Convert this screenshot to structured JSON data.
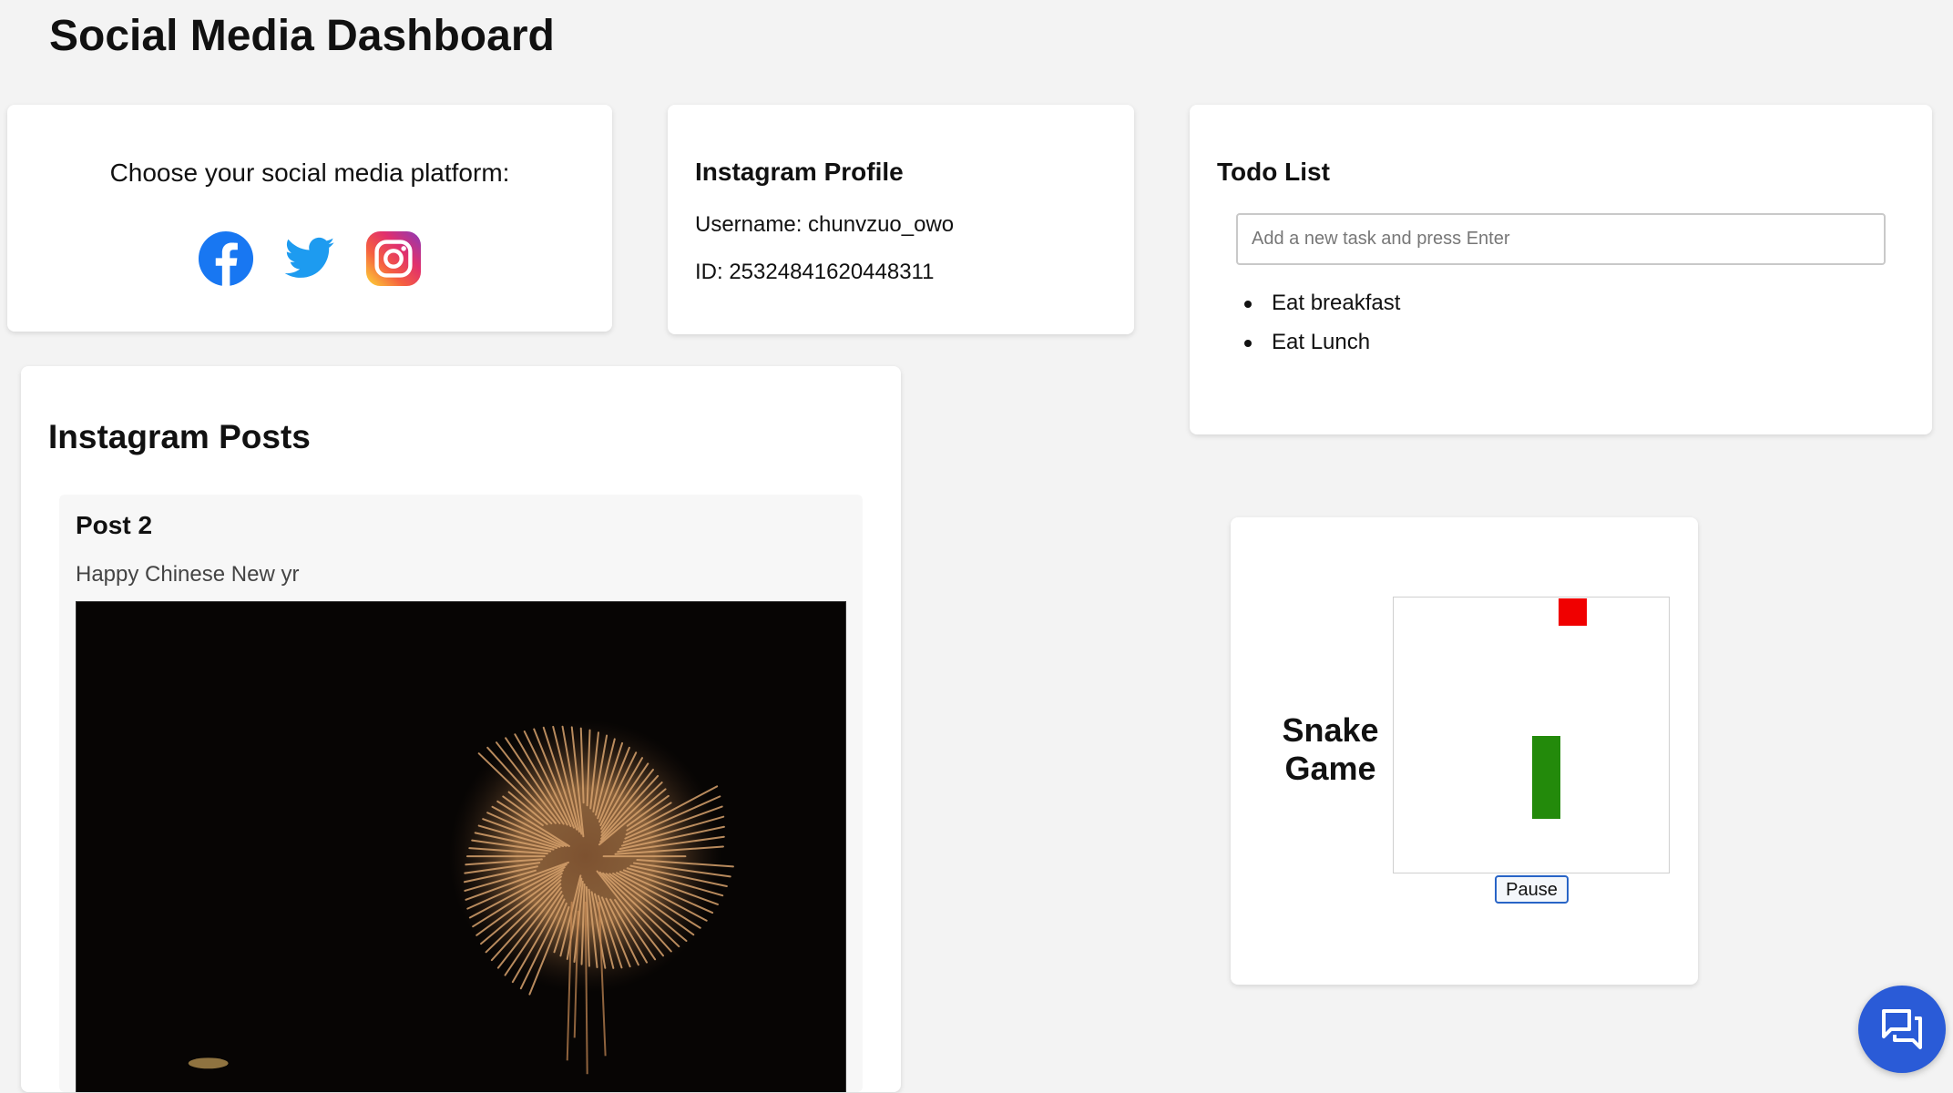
{
  "header": {
    "title": "Social Media Dashboard"
  },
  "platform_chooser": {
    "label": "Choose your social media platform:",
    "platforms": [
      {
        "name": "facebook",
        "icon": "facebook-icon",
        "color": "#1877f2"
      },
      {
        "name": "twitter",
        "icon": "twitter-icon",
        "color": "#1d9bf0"
      },
      {
        "name": "instagram",
        "icon": "instagram-icon",
        "color": "#e1306c"
      }
    ]
  },
  "profile": {
    "heading": "Instagram Profile",
    "username_line": "Username: chunvzuo_owo",
    "id_line": "ID: 25324841620448311"
  },
  "todo": {
    "heading": "Todo List",
    "input_placeholder": "Add a new task and press Enter",
    "input_value": "",
    "items": [
      "Eat breakfast",
      "Eat Lunch"
    ]
  },
  "posts": {
    "heading": "Instagram Posts",
    "items": [
      {
        "title": "Post 2",
        "caption": "Happy Chinese New yr"
      }
    ]
  },
  "snake_game": {
    "title": "Snake Game",
    "pause_label": "Pause",
    "snake_color": "#238a0b",
    "food_color": "#f00000"
  },
  "chat": {
    "icon": "chat-bubbles-icon",
    "color": "#2a5bd7"
  }
}
